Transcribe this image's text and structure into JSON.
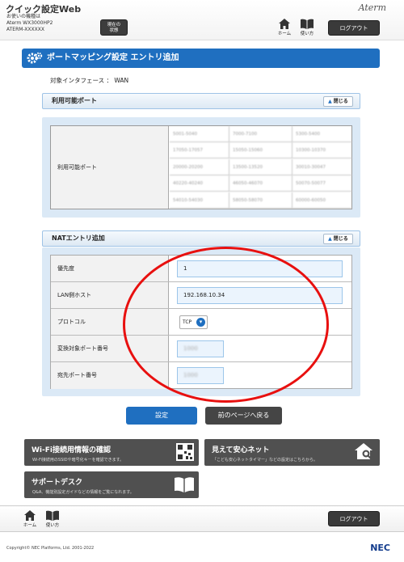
{
  "header": {
    "app_title": "クイック設定Web",
    "device_caption": "お使いの機種は",
    "device_model": "Aterm WX3000HP2",
    "device_name": "ATERM-XXXXXX",
    "status_button_line1": "現在の",
    "status_button_line2": "状態",
    "logo": "Aterm",
    "home_label": "ホーム",
    "manual_label": "使い方",
    "logout_label": "ログアウト"
  },
  "page": {
    "title": "ポートマッピング設定 エントリ追加",
    "target_interface": "対象インタフェース ： WAN"
  },
  "available_ports": {
    "section_title": "利用可能ポート",
    "close_label": "閉じる",
    "row_label": "利用可能ポート",
    "cells": [
      [
        "5001-5040",
        "7000-7100",
        "5300-5400"
      ],
      [
        "17050-17057",
        "15050-15060",
        "10300-10370"
      ],
      [
        "20000-20200",
        "13500-13520",
        "30010-30047"
      ],
      [
        "40220-40240",
        "46050-46070",
        "50070-50077"
      ],
      [
        "54010-54030",
        "58050-58070",
        "60000-60050"
      ]
    ]
  },
  "nat_entry": {
    "section_title": "NATエントリ追加",
    "close_label": "閉じる",
    "priority_label": "優先度",
    "priority_value": "1",
    "lan_host_label": "LAN側ホスト",
    "lan_host_value": "192.168.10.34",
    "protocol_label": "プロトコル",
    "protocol_value": "TCP",
    "convert_port_label": "変換対象ポート番号",
    "convert_port_value": "1000",
    "dest_port_label": "宛先ポート番号",
    "dest_port_value": "1000"
  },
  "actions": {
    "submit_label": "設定",
    "back_label": "前のページへ戻る"
  },
  "cards": {
    "wifi_title": "Wi-Fi接続用情報の確認",
    "wifi_desc": "Wi-Fi接続用のSSIDや暗号化キーを確認できます。",
    "safety_title": "見えて安心ネット",
    "safety_desc": "「こども安心ネットタイマー」などの設定はこちらから。",
    "support_title": "サポートデスク",
    "support_desc": "Q&A、機能別設定ガイドなどの情報をご覧になれます。"
  },
  "footer": {
    "home_label": "ホーム",
    "manual_label": "使い方",
    "logout_label": "ログアウト",
    "copyright": "Copyright© NEC Platforms, Ltd. 2001-2022",
    "brand": "NEC"
  },
  "colors": {
    "accent": "#1f6fc0",
    "dark_button": "#3a3a3a",
    "highlight_ellipse": "#e8100f",
    "section_bg": "#dbe9f6"
  }
}
